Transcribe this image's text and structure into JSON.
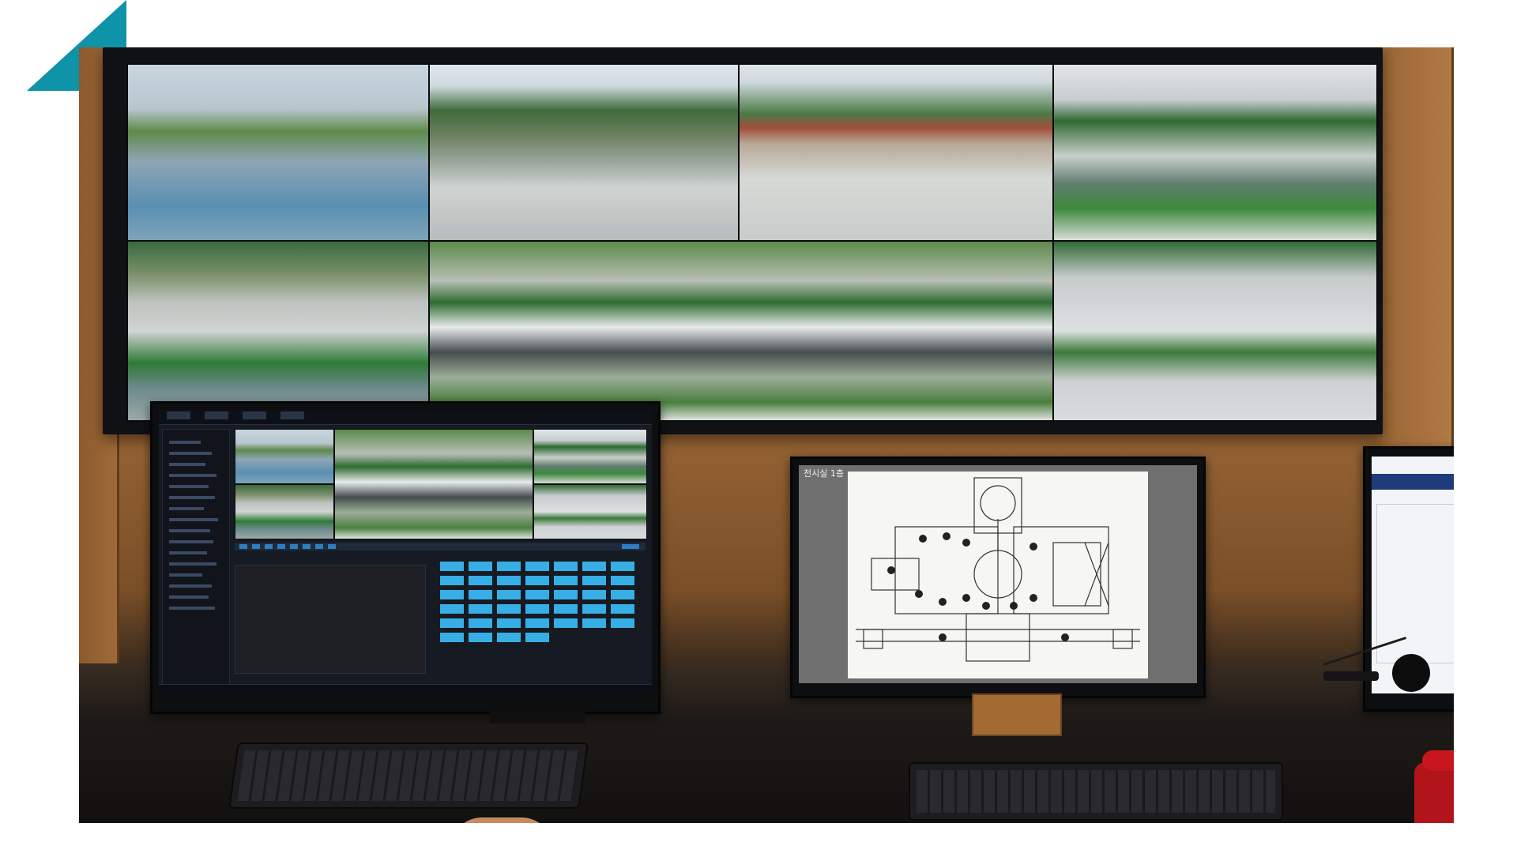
{
  "scene": {
    "description_kind": "photo",
    "accent_color": "#0e93a8",
    "vms_highlight_color": "#38aee6",
    "phone_color": "#b1141a"
  },
  "video_wall": {
    "cameras": [
      "cam-01",
      "cam-02",
      "cam-03",
      "cam-04",
      "cam-05",
      "cam-06",
      "cam-07"
    ]
  },
  "monitor_floor_plan": {
    "title_text": "전시실 1층"
  }
}
